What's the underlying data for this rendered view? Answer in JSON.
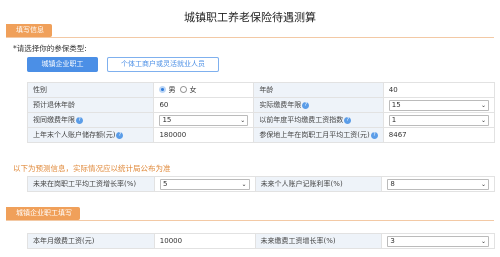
{
  "page": {
    "title": "城镇职工养老保险待遇测算"
  },
  "sections": {
    "info": "填写信息",
    "employee": "城镇企业职工填写"
  },
  "insured_type": {
    "label": "*请选择你的参保类型:",
    "options": [
      "城镇企业职工",
      "个体工商户或灵活就业人员"
    ],
    "selected": "城镇企业职工"
  },
  "form": {
    "gender_label": "性别",
    "gender_male": "男",
    "gender_female": "女",
    "gender_selected": "男",
    "age_label": "年龄",
    "age_value": "40",
    "retire_age_label": "预计退休年龄",
    "retire_age_value": "60",
    "actual_years_label": "实际缴费年限",
    "actual_years_value": "15",
    "deemed_years_label": "视同缴费年限",
    "deemed_years_value": "15",
    "prev_index_label": "以前年度平均缴费工资指数",
    "prev_index_value": "1",
    "account_balance_label": "上年末个人账户储存额(元)",
    "account_balance_value": "180000",
    "local_avg_wage_label": "参保地上年在岗职工月平均工资(元)",
    "local_avg_wage_value": "8467"
  },
  "forecast": {
    "note": "以下为预测信息，实际情况应以统计局公布为准",
    "wage_growth_label": "未来在岗职工平均工资增长率(%)",
    "wage_growth_value": "5",
    "account_rate_label": "未来个人账户记账利率(%)",
    "account_rate_value": "8"
  },
  "employee": {
    "monthly_wage_label": "本年月缴费工资(元)",
    "monthly_wage_value": "10000",
    "wage_growth_label": "未来缴费工资增长率(%)",
    "wage_growth_value": "3"
  },
  "icons": {
    "help": "question-circle-icon",
    "dropdown": "chevron-down-icon"
  },
  "colors": {
    "accent": "#4b8fe6",
    "section": "#f0a05a",
    "note": "#e0893a",
    "label_bg": "#eef3f9"
  }
}
